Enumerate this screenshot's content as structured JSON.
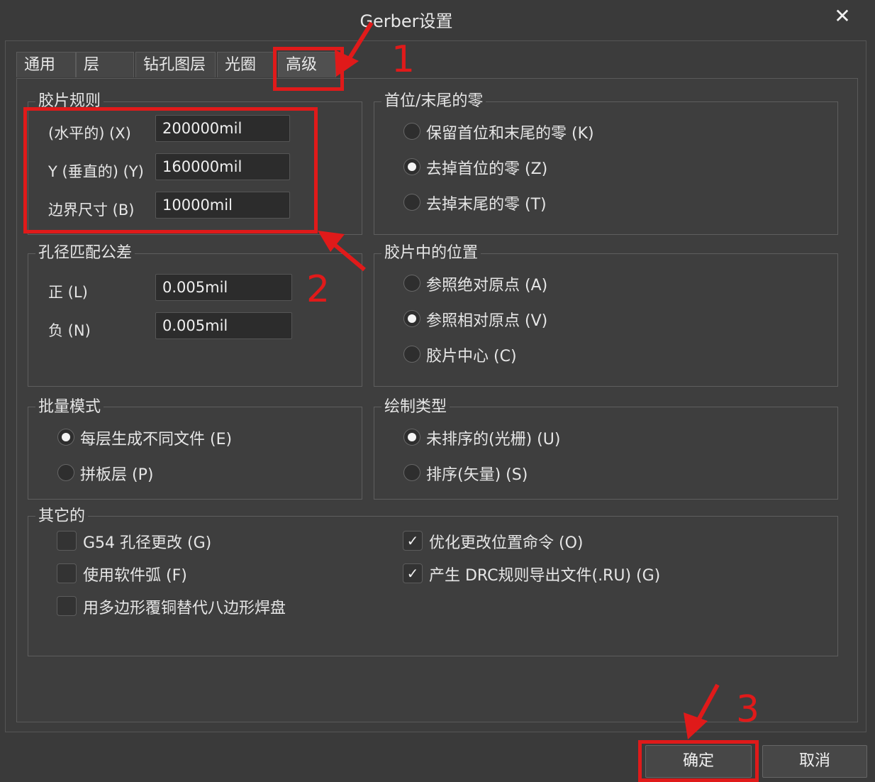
{
  "window": {
    "title": "Gerber设置",
    "close_glyph": "✕"
  },
  "tabs": [
    {
      "label": "通用"
    },
    {
      "label": "层"
    },
    {
      "label": "钻孔图层"
    },
    {
      "label": "光圈"
    },
    {
      "label": "高级",
      "active": true
    }
  ],
  "film_rules": {
    "legend": "胶片规则",
    "rows": [
      {
        "label": "(水平的) (X)",
        "value": "200000mil"
      },
      {
        "label": "Y (垂直的) (Y)",
        "value": "160000mil"
      },
      {
        "label": "边界尺寸 (B)",
        "value": "10000mil"
      }
    ]
  },
  "leading_trailing_zeros": {
    "legend": "首位/末尾的零",
    "options": [
      {
        "label": "保留首位和末尾的零 (K)",
        "selected": false
      },
      {
        "label": "去掉首位的零 (Z)",
        "selected": true
      },
      {
        "label": "去掉末尾的零 (T)",
        "selected": false
      }
    ]
  },
  "hole_tolerance": {
    "legend": "孔径匹配公差",
    "rows": [
      {
        "label": "正 (L)",
        "value": "0.005mil"
      },
      {
        "label": "负 (N)",
        "value": "0.005mil"
      }
    ]
  },
  "position_on_film": {
    "legend": "胶片中的位置",
    "options": [
      {
        "label": "参照绝对原点 (A)",
        "selected": false
      },
      {
        "label": "参照相对原点 (V)",
        "selected": true
      },
      {
        "label": "胶片中心 (C)",
        "selected": false
      }
    ]
  },
  "batch_mode": {
    "legend": "批量模式",
    "options": [
      {
        "label": "每层生成不同文件 (E)",
        "selected": true
      },
      {
        "label": "拼板层 (P)",
        "selected": false
      }
    ]
  },
  "plot_type": {
    "legend": "绘制类型",
    "options": [
      {
        "label": "未排序的(光栅) (U)",
        "selected": true
      },
      {
        "label": "排序(矢量) (S)",
        "selected": false
      }
    ]
  },
  "other": {
    "legend": "其它的",
    "checkboxes": [
      {
        "label": "G54 孔径更改 (G)",
        "checked": false
      },
      {
        "label": "使用软件弧 (F)",
        "checked": false
      },
      {
        "label": "用多边形覆铜替代八边形焊盘",
        "checked": false
      },
      {
        "label": "优化更改位置命令 (O)",
        "checked": true
      },
      {
        "label": "产生 DRC规则导出文件(.RU) (G)",
        "checked": true
      }
    ],
    "check_glyph": "✓"
  },
  "buttons": {
    "ok": "确定",
    "cancel": "取消"
  },
  "annotations": {
    "step1": "1",
    "step2": "2",
    "step3": "3",
    "color": "#e01a1a"
  }
}
